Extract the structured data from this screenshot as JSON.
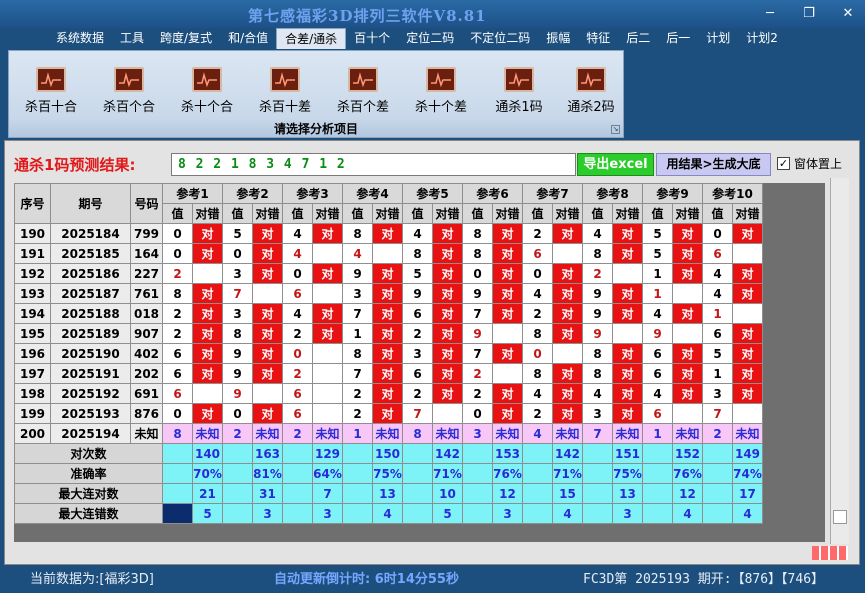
{
  "window": {
    "title": "第七感福彩3D排列三软件V8.81"
  },
  "menu": [
    "系统数据",
    "工具",
    "跨度/复式",
    "和/合值",
    "合差/通杀",
    "百十个",
    "定位二码",
    "不定位二码",
    "振幅",
    "特征",
    "后二",
    "后一",
    "计划",
    "计划2"
  ],
  "menu_active": 4,
  "ribbon": {
    "buttons": [
      "杀百十合",
      "杀百个合",
      "杀十个合",
      "杀百十差",
      "杀百个差",
      "杀十个差",
      "通杀1码",
      "通杀2码"
    ],
    "caption": "请选择分析项目"
  },
  "result": {
    "label": "通杀1码预测结果:",
    "value": "8 2 2 1 8 3 4 7 1 2",
    "export_button": "导出excel",
    "generate_button": "用结果>生成大底",
    "topmost_checkbox": "窗体置上"
  },
  "table": {
    "headers": {
      "seq": "序号",
      "period": "期号",
      "number": "号码",
      "value": "值",
      "check": "对错"
    },
    "refs": [
      "参考1",
      "参考2",
      "参考3",
      "参考4",
      "参考5",
      "参考6",
      "参考7",
      "参考8",
      "参考9",
      "参考10"
    ],
    "ok_text": "对",
    "rows": [
      {
        "seq": "190",
        "period": "2025184",
        "number": "799",
        "cells": [
          [
            "0",
            "对"
          ],
          [
            "5",
            "对"
          ],
          [
            "4",
            "对"
          ],
          [
            "8",
            "对"
          ],
          [
            "4",
            "对"
          ],
          [
            "8",
            "对"
          ],
          [
            "2",
            "对"
          ],
          [
            "4",
            "对"
          ],
          [
            "5",
            "对"
          ],
          [
            "0",
            "对"
          ]
        ]
      },
      {
        "seq": "191",
        "period": "2025185",
        "number": "164",
        "cells": [
          [
            "0",
            "对"
          ],
          [
            "0",
            "对"
          ],
          [
            "4",
            ""
          ],
          [
            "4",
            ""
          ],
          [
            "8",
            "对"
          ],
          [
            "8",
            "对"
          ],
          [
            "6",
            ""
          ],
          [
            "8",
            "对"
          ],
          [
            "5",
            "对"
          ],
          [
            "6",
            ""
          ]
        ]
      },
      {
        "seq": "192",
        "period": "2025186",
        "number": "227",
        "cells": [
          [
            "2",
            ""
          ],
          [
            "3",
            "对"
          ],
          [
            "0",
            "对"
          ],
          [
            "9",
            "对"
          ],
          [
            "5",
            "对"
          ],
          [
            "0",
            "对"
          ],
          [
            "0",
            "对"
          ],
          [
            "2",
            ""
          ],
          [
            "1",
            "对"
          ],
          [
            "4",
            "对"
          ]
        ]
      },
      {
        "seq": "193",
        "period": "2025187",
        "number": "761",
        "cells": [
          [
            "8",
            "对"
          ],
          [
            "7",
            ""
          ],
          [
            "6",
            ""
          ],
          [
            "3",
            "对"
          ],
          [
            "9",
            "对"
          ],
          [
            "9",
            "对"
          ],
          [
            "4",
            "对"
          ],
          [
            "9",
            "对"
          ],
          [
            "1",
            ""
          ],
          [
            "4",
            "对"
          ]
        ]
      },
      {
        "seq": "194",
        "period": "2025188",
        "number": "018",
        "cells": [
          [
            "2",
            "对"
          ],
          [
            "3",
            "对"
          ],
          [
            "4",
            "对"
          ],
          [
            "7",
            "对"
          ],
          [
            "6",
            "对"
          ],
          [
            "7",
            "对"
          ],
          [
            "2",
            "对"
          ],
          [
            "9",
            "对"
          ],
          [
            "4",
            "对"
          ],
          [
            "1",
            ""
          ]
        ]
      },
      {
        "seq": "195",
        "period": "2025189",
        "number": "907",
        "cells": [
          [
            "2",
            "对"
          ],
          [
            "8",
            "对"
          ],
          [
            "2",
            "对"
          ],
          [
            "1",
            "对"
          ],
          [
            "2",
            "对"
          ],
          [
            "9",
            ""
          ],
          [
            "8",
            "对"
          ],
          [
            "9",
            ""
          ],
          [
            "9",
            ""
          ],
          [
            "6",
            "对"
          ]
        ]
      },
      {
        "seq": "196",
        "period": "2025190",
        "number": "402",
        "cells": [
          [
            "6",
            "对"
          ],
          [
            "9",
            "对"
          ],
          [
            "0",
            ""
          ],
          [
            "8",
            "对"
          ],
          [
            "3",
            "对"
          ],
          [
            "7",
            "对"
          ],
          [
            "0",
            ""
          ],
          [
            "8",
            "对"
          ],
          [
            "6",
            "对"
          ],
          [
            "5",
            "对"
          ]
        ]
      },
      {
        "seq": "197",
        "period": "2025191",
        "number": "202",
        "cells": [
          [
            "6",
            "对"
          ],
          [
            "9",
            "对"
          ],
          [
            "2",
            ""
          ],
          [
            "7",
            "对"
          ],
          [
            "6",
            "对"
          ],
          [
            "2",
            ""
          ],
          [
            "8",
            "对"
          ],
          [
            "8",
            "对"
          ],
          [
            "6",
            "对"
          ],
          [
            "1",
            "对"
          ]
        ]
      },
      {
        "seq": "198",
        "period": "2025192",
        "number": "691",
        "cells": [
          [
            "6",
            ""
          ],
          [
            "9",
            ""
          ],
          [
            "6",
            ""
          ],
          [
            "2",
            "对"
          ],
          [
            "2",
            "对"
          ],
          [
            "2",
            "对"
          ],
          [
            "4",
            "对"
          ],
          [
            "4",
            "对"
          ],
          [
            "4",
            "对"
          ],
          [
            "3",
            "对"
          ]
        ]
      },
      {
        "seq": "199",
        "period": "2025193",
        "number": "876",
        "cells": [
          [
            "0",
            "对"
          ],
          [
            "0",
            "对"
          ],
          [
            "6",
            ""
          ],
          [
            "2",
            "对"
          ],
          [
            "7",
            ""
          ],
          [
            "0",
            "对"
          ],
          [
            "2",
            "对"
          ],
          [
            "3",
            "对"
          ],
          [
            "6",
            ""
          ],
          [
            "7",
            ""
          ]
        ]
      }
    ],
    "prediction": {
      "seq": "200",
      "period": "2025194",
      "number": "未知",
      "values": [
        "8",
        "2",
        "2",
        "1",
        "8",
        "3",
        "4",
        "7",
        "1",
        "2"
      ],
      "unknown": "未知"
    },
    "stats": [
      {
        "label": "对次数",
        "values": [
          "140",
          "163",
          "129",
          "150",
          "142",
          "153",
          "142",
          "151",
          "152",
          "149"
        ]
      },
      {
        "label": "准确率",
        "values": [
          "70%",
          "81%",
          "64%",
          "75%",
          "71%",
          "76%",
          "71%",
          "75%",
          "76%",
          "74%"
        ]
      },
      {
        "label": "最大连对数",
        "values": [
          "21",
          "31",
          "7",
          "13",
          "10",
          "12",
          "15",
          "13",
          "12",
          "17"
        ]
      },
      {
        "label": "最大连错数",
        "values": [
          "5",
          "3",
          "3",
          "4",
          "5",
          "3",
          "4",
          "3",
          "4",
          "4"
        ]
      }
    ]
  },
  "status": {
    "current_data": "当前数据为:[福彩3D]",
    "countdown": "自动更新倒计时: 6时14分55秒",
    "draw_info": "FC3D第 2025193 期开:【876】【746】"
  }
}
